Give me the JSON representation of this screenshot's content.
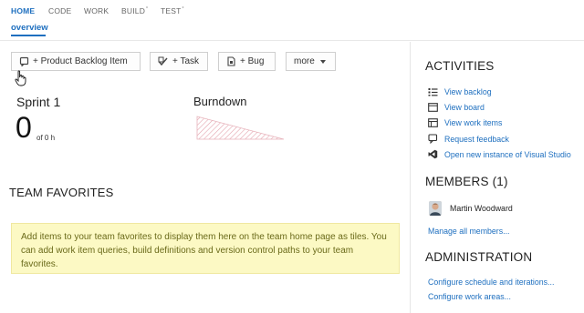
{
  "topnav": [
    {
      "label": "HOME",
      "suffix": ""
    },
    {
      "label": "CODE",
      "suffix": ""
    },
    {
      "label": "WORK",
      "suffix": ""
    },
    {
      "label": "BUILD",
      "suffix": "°"
    },
    {
      "label": "TEST",
      "suffix": "°"
    }
  ],
  "subnav": {
    "label": "overview"
  },
  "toolbar": {
    "pbi_label": "+ Product Backlog Item",
    "task_label": "+ Task",
    "bug_label": "+ Bug",
    "more_label": "more"
  },
  "sprint": {
    "title": "Sprint 1",
    "remaining": "0",
    "of_text": "of 0 h"
  },
  "burndown": {
    "title": "Burndown"
  },
  "favorites": {
    "title": "TEAM FAVORITES",
    "message": "Add items to your team favorites to display them here on the team home page as tiles. You can add work item queries, build definitions and version control paths to your team favorites."
  },
  "activities": {
    "title": "ACTIVITIES",
    "items": [
      {
        "label": "View backlog",
        "icon": "backlog-icon"
      },
      {
        "label": "View board",
        "icon": "board-icon"
      },
      {
        "label": "View work items",
        "icon": "work-items-icon"
      },
      {
        "label": "Request feedback",
        "icon": "feedback-icon"
      },
      {
        "label": "Open new instance of Visual Studio",
        "icon": "visual-studio-icon"
      }
    ]
  },
  "members": {
    "title": "MEMBERS (1)",
    "list": [
      {
        "name": "Martin Woodward"
      }
    ],
    "manage_label": "Manage all members..."
  },
  "administration": {
    "title": "ADMINISTRATION",
    "links": [
      {
        "label": "Configure schedule and iterations..."
      },
      {
        "label": "Configure work areas..."
      }
    ]
  },
  "colors": {
    "accent": "#1e6fbf",
    "favorites_bg": "#fcf9c4",
    "burndown": "#e0a0a8"
  }
}
